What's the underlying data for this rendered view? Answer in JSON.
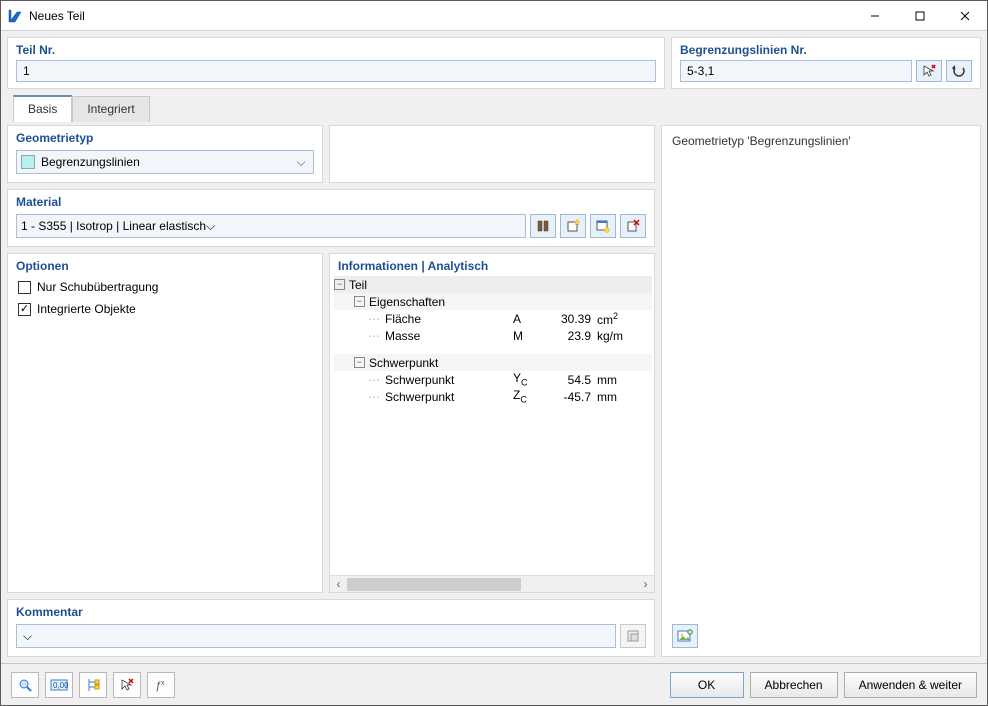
{
  "title": "Neues Teil",
  "top": {
    "teil_label": "Teil Nr.",
    "teil_value": "1",
    "begrenz_label": "Begrenzungslinien Nr.",
    "begrenz_value": "5-3,1"
  },
  "tabs": {
    "basis": "Basis",
    "integriert": "Integriert"
  },
  "geo": {
    "heading": "Geometrietyp",
    "value": "Begrenzungslinien",
    "swatch": "#b8f0ee"
  },
  "material": {
    "heading": "Material",
    "value": "1 - S355 | Isotrop | Linear elastisch",
    "swatch": "#3a7bd5"
  },
  "options": {
    "heading": "Optionen",
    "opt1": {
      "label": "Nur Schubübertragung",
      "checked": false
    },
    "opt2": {
      "label": "Integrierte Objekte",
      "checked": true
    }
  },
  "info": {
    "heading": "Informationen | Analytisch",
    "teil": "Teil",
    "eig": "Eigenschaften",
    "rows": {
      "flaeche": {
        "name": "Fläche",
        "sym": "A",
        "val": "30.39",
        "unit_html": "cm<sup>2</sup>"
      },
      "masse": {
        "name": "Masse",
        "sym": "M",
        "val": "23.9",
        "unit": "kg/m"
      }
    },
    "schwer": "Schwerpunkt",
    "srows": {
      "y": {
        "name": "Schwerpunkt",
        "sym_html": "Y<sub>C</sub>",
        "val": "54.5",
        "unit": "mm"
      },
      "z": {
        "name": "Schwerpunkt",
        "sym_html": "Z<sub>C</sub>",
        "val": "-45.7",
        "unit": "mm"
      }
    }
  },
  "right": {
    "text": "Geometrietyp 'Begrenzungslinien'"
  },
  "kommentar": {
    "heading": "Kommentar"
  },
  "footer": {
    "ok": "OK",
    "cancel": "Abbrechen",
    "apply": "Anwenden & weiter"
  }
}
